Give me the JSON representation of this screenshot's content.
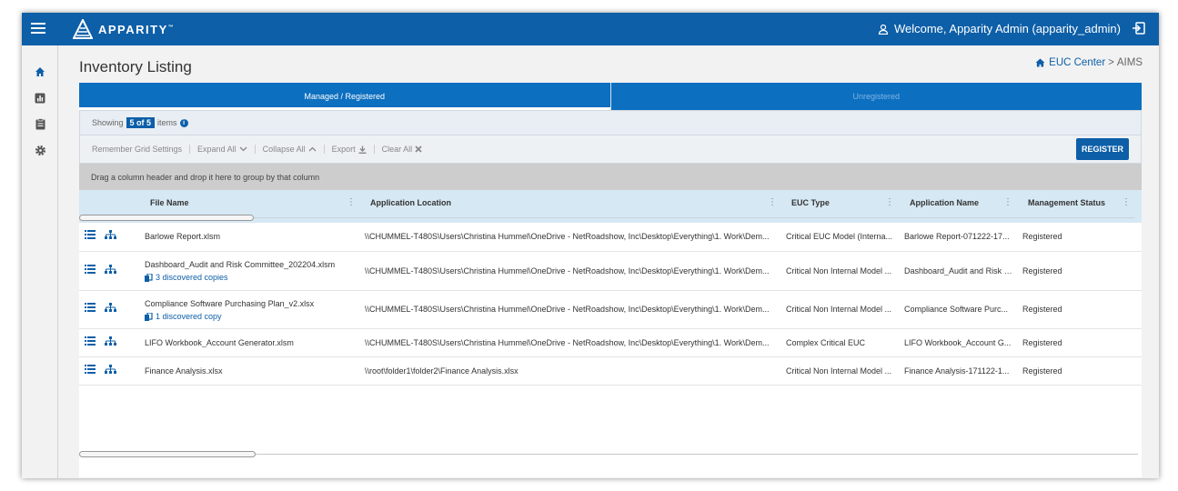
{
  "header": {
    "brand": "APPARITY",
    "trademark": "™",
    "welcome": "Welcome, Apparity Admin (apparity_admin)"
  },
  "sidebar": {
    "items": [
      {
        "icon": "home-icon"
      },
      {
        "icon": "bar-chart-icon"
      },
      {
        "icon": "clipboard-icon"
      },
      {
        "icon": "gear-icon"
      }
    ]
  },
  "page": {
    "title": "Inventory Listing",
    "breadcrumb": {
      "link": "EUC Center",
      "separator": ">",
      "current": "AIMS"
    }
  },
  "tabs": [
    {
      "label": "Managed / Registered",
      "active": true
    },
    {
      "label": "Unregistered",
      "active": false
    }
  ],
  "summary": {
    "prefix": "Showing",
    "badge": "5 of 5",
    "suffix": "items"
  },
  "toolbar": {
    "remember": "Remember Grid Settings",
    "expand": "Expand All",
    "collapse": "Collapse All",
    "export": "Export",
    "clear": "Clear All",
    "register": "REGISTER"
  },
  "group_hint": "Drag a column header and drop it here to group by that column",
  "grid": {
    "columns": [
      "File Name",
      "Application Location",
      "EUC Type",
      "Application Name",
      "Management Status"
    ],
    "rows": [
      {
        "file": "Barlowe Report.xlsm",
        "location": "\\\\CHUMMEL-T480S\\Users\\Christina Hummel\\OneDrive - NetRoadshow, Inc\\Desktop\\Everything\\1. Work\\Dem...",
        "type": "Critical EUC Model (Interna...",
        "app": "Barlowe Report-071222-17...",
        "status": "Registered",
        "copies": ""
      },
      {
        "file": "Dashboard_Audit and Risk Committee_202204.xlsm",
        "location": "\\\\CHUMMEL-T480S\\Users\\Christina Hummel\\OneDrive - NetRoadshow, Inc\\Desktop\\Everything\\1. Work\\Dem...",
        "type": "Critical Non Internal Model ...",
        "app": "Dashboard_Audit and Risk -...",
        "status": "Registered",
        "copies": "3 discovered copies"
      },
      {
        "file": "Compliance Software Purchasing Plan_v2.xlsx",
        "location": "\\\\CHUMMEL-T480S\\Users\\Christina Hummel\\OneDrive - NetRoadshow, Inc\\Desktop\\Everything\\1. Work\\Dem...",
        "type": "Critical Non Internal Model ...",
        "app": "Compliance Software Purc...",
        "status": "Registered",
        "copies": "1 discovered copy"
      },
      {
        "file": "LIFO Workbook_Account Generator.xlsm",
        "location": "\\\\CHUMMEL-T480S\\Users\\Christina Hummel\\OneDrive - NetRoadshow, Inc\\Desktop\\Everything\\1. Work\\Dem...",
        "type": "Complex Critical EUC",
        "app": "LIFO Workbook_Account G...",
        "status": "Registered",
        "copies": ""
      },
      {
        "file": "Finance Analysis.xlsx",
        "location": "\\\\root\\folder1\\folder2\\Finance Analysis.xlsx",
        "type": "Critical Non Internal Model ...",
        "app": "Finance Analysis-171122-1...",
        "status": "Registered",
        "copies": ""
      }
    ]
  },
  "colors": {
    "primary": "#0d5fa8",
    "tab_bar": "#0d6fbf",
    "header_row": "#d6e8f3"
  }
}
